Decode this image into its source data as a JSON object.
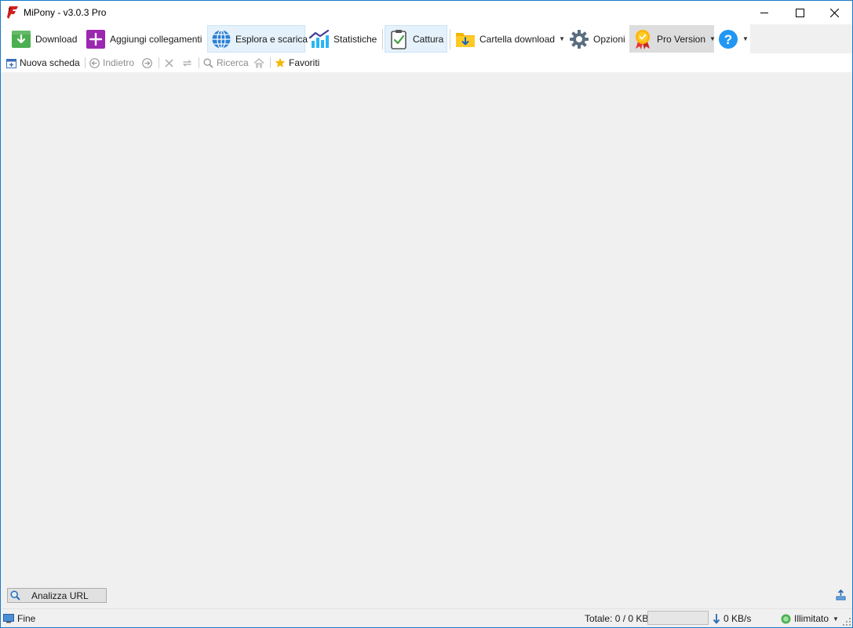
{
  "window": {
    "title": "MiPony - v3.0.3 Pro"
  },
  "toolbar": {
    "download": "Download",
    "add_links": "Aggiungi collegamenti",
    "browse": "Esplora e scarica",
    "stats": "Statistiche",
    "capture": "Cattura",
    "download_folder": "Cartella download",
    "options": "Opzioni",
    "pro": "Pro Version"
  },
  "subbar": {
    "new_tab": "Nuova scheda",
    "back": "Indietro",
    "search": "Ricerca",
    "favorites": "Favoriti"
  },
  "bottom": {
    "analyze": "Analizza URL"
  },
  "status": {
    "state": "Fine",
    "total": "Totale: 0 / 0 KB",
    "speed": "0 KB/s",
    "limit": "Illimitato"
  },
  "colors": {
    "accent_border": "#1979ca",
    "active_tab_bg": "#e5f1fb",
    "pro_bg": "#dddddd",
    "content_bg": "#f0f0f0"
  }
}
